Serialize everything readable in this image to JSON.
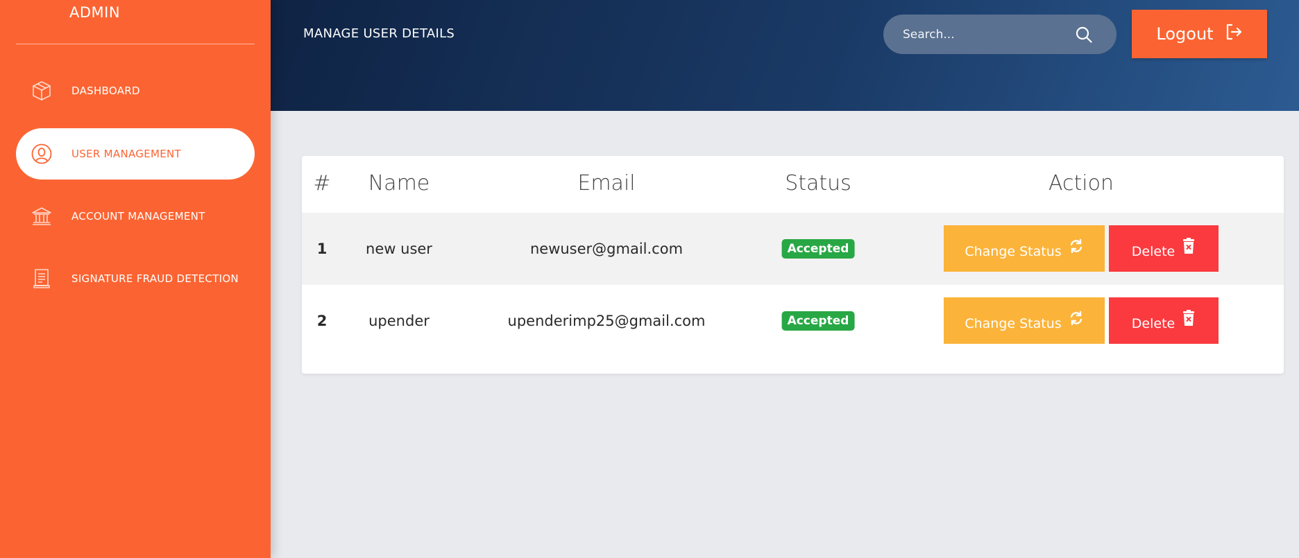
{
  "sidebar": {
    "brand": "ADMIN",
    "items": [
      {
        "label": "DASHBOARD",
        "icon": "cube-icon"
      },
      {
        "label": "USER MANAGEMENT",
        "icon": "user-circle-icon",
        "active": true
      },
      {
        "label": "ACCOUNT MANAGEMENT",
        "icon": "bank-icon"
      },
      {
        "label": "SIGNATURE FRAUD DETECTION",
        "icon": "document-icon"
      }
    ]
  },
  "header": {
    "title": "MANAGE USER DETAILS",
    "search_placeholder": "Search...",
    "logout_label": "Logout"
  },
  "table": {
    "headers": [
      "#",
      "Name",
      "Email",
      "Status",
      "Action"
    ],
    "rows": [
      {
        "index": "1",
        "name": "new user",
        "email": "newuser@gmail.com",
        "status": "Accepted"
      },
      {
        "index": "2",
        "name": "upender",
        "email": "upenderimp25@gmail.com",
        "status": "Accepted"
      }
    ],
    "change_status_label": "Change Status",
    "delete_label": "Delete"
  },
  "colors": {
    "sidebar": "#fb6432",
    "accent": "#fb6432",
    "status_accepted": "#28a745",
    "change_status": "#fbb33a",
    "delete": "#fa3a3f"
  }
}
